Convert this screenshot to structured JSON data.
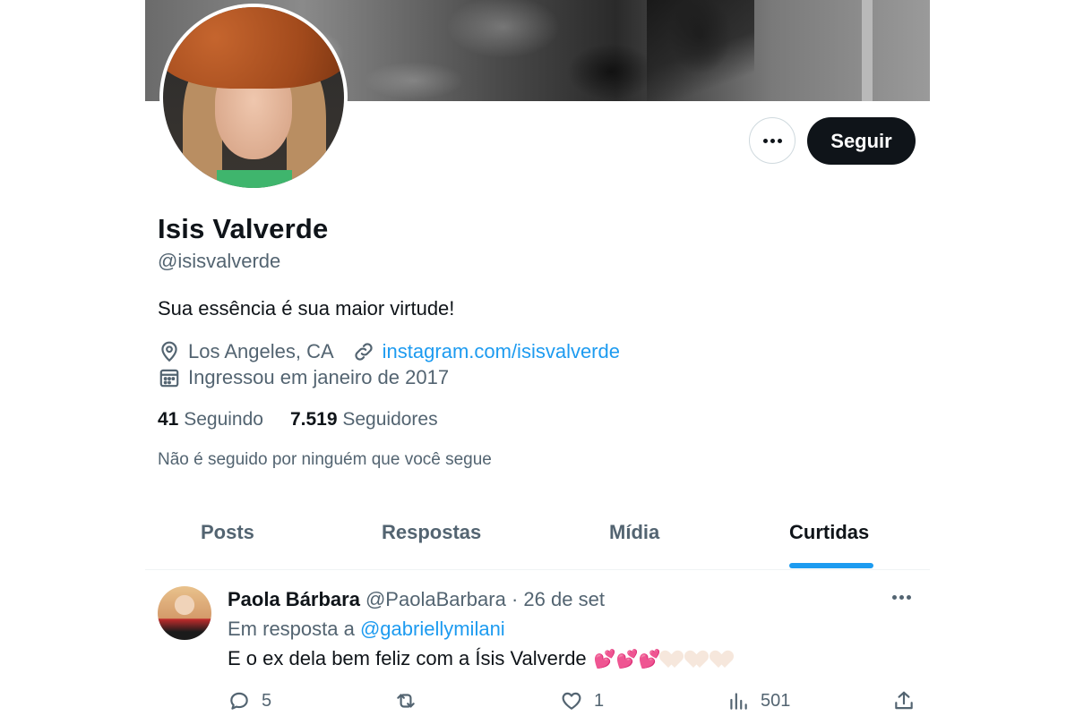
{
  "profile": {
    "name": "Isis Valverde",
    "handle": "@isisvalverde",
    "bio": "Sua essência é sua maior virtude!",
    "location": "Los Angeles, CA",
    "website": "instagram.com/isisvalverde",
    "joined": "Ingressou em janeiro de 2017",
    "following_count": "41",
    "following_label": "Seguindo",
    "followers_count": "7.519",
    "followers_label": "Seguidores",
    "not_followed_text": "Não é seguido por ninguém que você segue",
    "follow_button": "Seguir"
  },
  "tabs": [
    {
      "label": "Posts",
      "active": false
    },
    {
      "label": "Respostas",
      "active": false
    },
    {
      "label": "Mídia",
      "active": false
    },
    {
      "label": "Curtidas",
      "active": true
    }
  ],
  "tweet": {
    "author_name": "Paola Bárbara",
    "author_handle": "@PaolaBarbara",
    "separator": "·",
    "date": "26 de set",
    "reply_prefix": "Em resposta a",
    "reply_mention": "@gabriellymilani",
    "text": "E o ex dela bem feliz com a Ísis Valverde",
    "emojis": "💕💕💕",
    "replies": "5",
    "retweets": "",
    "likes": "1",
    "views": "501"
  },
  "colors": {
    "accent": "#1d9bf0",
    "text_primary": "#0f1419",
    "text_secondary": "#536471",
    "button_dark": "#0f1419"
  },
  "icons": [
    "more-icon",
    "location-icon",
    "link-icon",
    "calendar-icon",
    "reply-icon",
    "retweet-icon",
    "like-icon",
    "views-icon",
    "share-icon"
  ]
}
